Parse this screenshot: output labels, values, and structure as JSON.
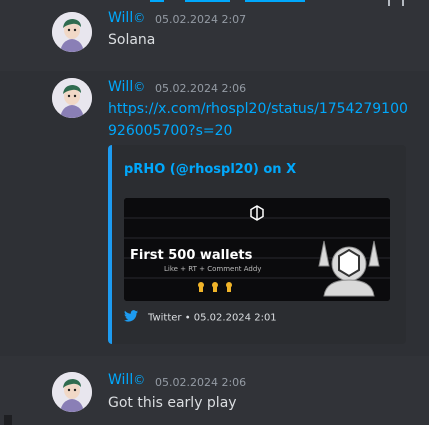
{
  "messages": [
    {
      "author": "Will",
      "badge": "©",
      "timestamp": "05.02.2024 2:07",
      "text": "Solana"
    },
    {
      "author": "Will",
      "badge": "©",
      "timestamp": "05.02.2024 2:06",
      "link": "https://x.com/rhospl20/status/1754279100926005700?s=20",
      "embed": {
        "title": "pRHO (@rhospl20) on X",
        "image_headline": "First 500 wallets",
        "image_subline": "Like + RT + Comment Addy",
        "footer": "Twitter • 05.02.2024 2:01",
        "icon": "twitter-icon",
        "accent": "#1d9bf0"
      }
    },
    {
      "author": "Will",
      "badge": "©",
      "timestamp": "05.02.2024 2:06",
      "text": "Got this early play"
    }
  ],
  "colors": {
    "background": "#313338",
    "highlight": "#2e3035",
    "author": "#00a8fc",
    "link": "#00a8fc",
    "muted": "#949ba4"
  }
}
